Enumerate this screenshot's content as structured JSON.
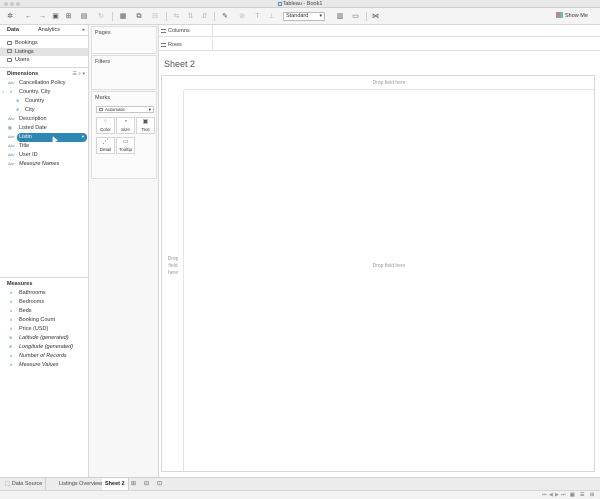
{
  "window": {
    "title": "Tableau - Book1"
  },
  "toolbar": {
    "format_select": "Standard",
    "show_me": "Show Me"
  },
  "data_pane": {
    "tabs": [
      "Data",
      "Analytics"
    ],
    "data_sources": [
      {
        "label": "Bookings",
        "selected": false
      },
      {
        "label": "Listings",
        "selected": true
      },
      {
        "label": "Users",
        "selected": false
      }
    ],
    "dimensions_header": "Dimensions",
    "dimensions": [
      {
        "label": "Cancellation Policy",
        "icon": "abc-icon"
      },
      {
        "label": "Country, City",
        "icon": "hierarchy-icon"
      },
      {
        "label": "Country",
        "icon": "globe-icon"
      },
      {
        "label": "City",
        "icon": "globe-icon"
      },
      {
        "label": "Description",
        "icon": "abc-icon"
      },
      {
        "label": "Listed Date",
        "icon": "calendar-icon"
      },
      {
        "label": "Listing ID",
        "icon": "abc-icon"
      },
      {
        "label": "Title",
        "icon": "abc-icon"
      },
      {
        "label": "User ID",
        "icon": "abc-icon"
      },
      {
        "label": "Measure Names",
        "icon": "abc-icon"
      }
    ],
    "dragging_label": "Listin",
    "measures_header": "Measures",
    "measures": [
      {
        "label": "Bathrooms",
        "icon": "hash-icon"
      },
      {
        "label": "Bedrooms",
        "icon": "hash-icon"
      },
      {
        "label": "Beds",
        "icon": "hash-icon"
      },
      {
        "label": "Booking Count",
        "icon": "hash-icon"
      },
      {
        "label": "Price (USD)",
        "icon": "hash-icon"
      },
      {
        "label": "Latitude (generated)",
        "icon": "globe-icon"
      },
      {
        "label": "Longitude (generated)",
        "icon": "globe-icon"
      },
      {
        "label": "Number of Records",
        "icon": "hash-icon"
      },
      {
        "label": "Measure Values",
        "icon": "hash-icon"
      }
    ]
  },
  "cards": {
    "pages": "Pages",
    "filters": "Filters",
    "marks": "Marks",
    "mark_type": "Automatic",
    "mark_buttons": [
      "Color",
      "Size",
      "Text",
      "Detail",
      "Tooltip"
    ]
  },
  "shelves": {
    "columns": "Columns",
    "rows": "Rows"
  },
  "sheet": {
    "title": "Sheet 2",
    "drop_field": "Drop field here",
    "drop_row_line1": "Drop",
    "drop_row_line2": "field",
    "drop_row_line3": "here"
  },
  "bottom_tabs": [
    "Data Source",
    "Listings Overview",
    "Sheet 2"
  ]
}
